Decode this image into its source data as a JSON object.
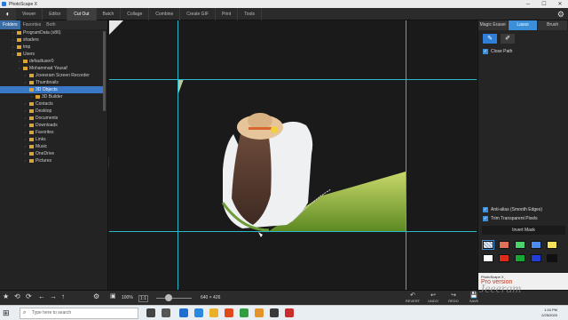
{
  "window": {
    "title": "PhotoScape X",
    "controls": [
      "─",
      "☐",
      "✕"
    ]
  },
  "menu": {
    "tabs": [
      "Viewer",
      "Editor",
      "Cut Out",
      "Batch",
      "Collage",
      "Combine",
      "Create GIF",
      "Print",
      "Tools"
    ],
    "active_index": 2
  },
  "left_panel": {
    "tabs": [
      "Folders",
      "Favorites",
      "Both"
    ],
    "active_tab": 0,
    "tree": [
      {
        "label": "ProgramData (x86)",
        "indent": 2
      },
      {
        "label": "shaders",
        "indent": 2
      },
      {
        "label": "tmp",
        "indent": 2
      },
      {
        "label": "Users",
        "indent": 2
      },
      {
        "label": "defaultuser0",
        "indent": 3
      },
      {
        "label": "Mohammad Yousaf",
        "indent": 3
      },
      {
        "label": "Jceesram Screen Recorder",
        "indent": 4
      },
      {
        "label": "Thumbnails",
        "indent": 4
      },
      {
        "label": "3D Objects",
        "indent": 4,
        "selected": true
      },
      {
        "label": "3D Builder",
        "indent": 5
      },
      {
        "label": "Contacts",
        "indent": 4
      },
      {
        "label": "Desktop",
        "indent": 4
      },
      {
        "label": "Documents",
        "indent": 4
      },
      {
        "label": "Downloads",
        "indent": 4
      },
      {
        "label": "Favorites",
        "indent": 4
      },
      {
        "label": "Links",
        "indent": 4
      },
      {
        "label": "Music",
        "indent": 4
      },
      {
        "label": "OneDrive",
        "indent": 4
      },
      {
        "label": "Pictures",
        "indent": 4
      }
    ]
  },
  "right_panel": {
    "tabs": [
      "Magic Eraser",
      "Lasso",
      "Brush"
    ],
    "active_tab": 1,
    "close_path": "Close Path",
    "antialias": "Anti-alias (Smooth Edges)",
    "trim": "Trim Transparent Pixels",
    "invert": "Invert Mask",
    "swatches": [
      "#dfe7f5",
      "#e0705a",
      "#4bd26a",
      "#4a8cf0",
      "#f2e35a",
      "#ffffff",
      "#e02a1a",
      "#17a834",
      "#1f3fd8",
      "#111111"
    ],
    "promo_small": "PhotoScape X",
    "promo_big": "Pro version"
  },
  "bottom": {
    "zoom": "100%",
    "ratio": "1:1",
    "dims": "640 × 426",
    "actions": [
      "REVERT",
      "UNDO",
      "REDO",
      "SAVE"
    ]
  },
  "taskbar": {
    "search_placeholder": "Type here to search",
    "time": "1:16 PM",
    "date": "2/25/2020"
  },
  "watermark": "Jeeeram"
}
